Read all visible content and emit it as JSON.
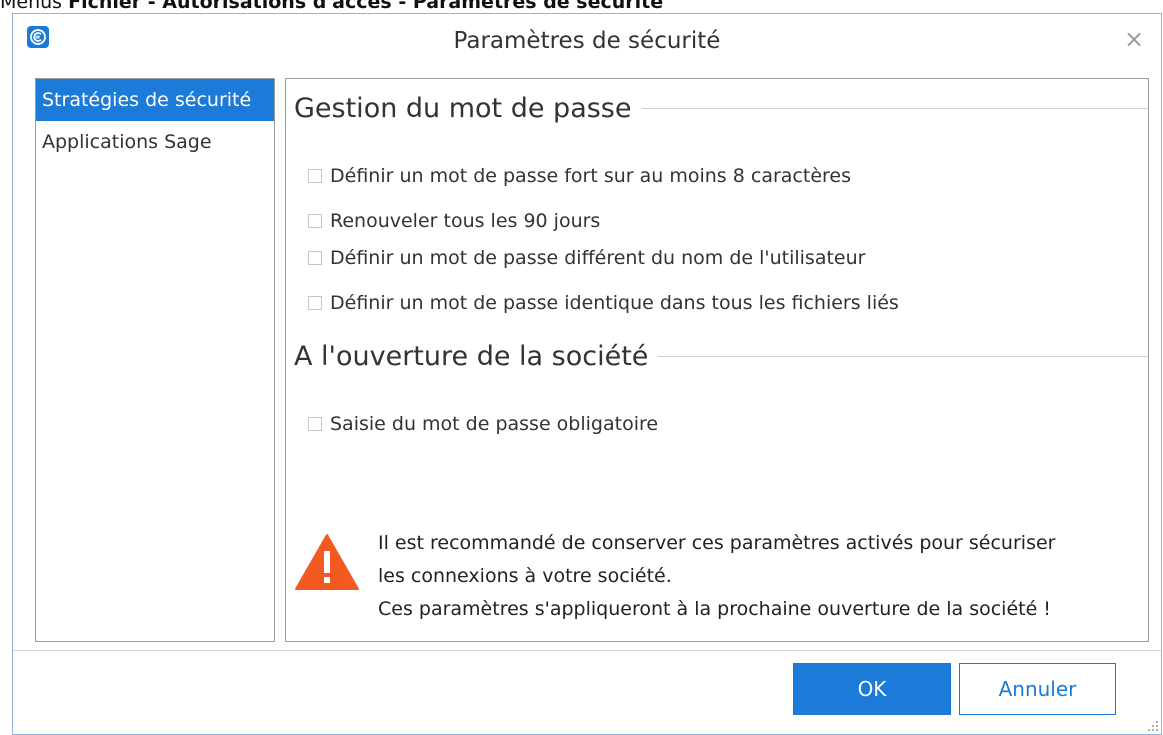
{
  "caption": {
    "prefix": "Menus ",
    "path": "Fichier - Autorisations d'accès - Paramètres de sécurité"
  },
  "dialog": {
    "title": "Paramètres de sécurité",
    "close_glyph": "×"
  },
  "sidebar": {
    "items": [
      {
        "label": "Stratégies de sécurité",
        "active": true
      },
      {
        "label": "Applications Sage",
        "active": false
      }
    ]
  },
  "sections": {
    "password": {
      "title": "Gestion du mot de passe",
      "options": [
        {
          "label": "Définir un mot de passe fort sur au moins 8 caractères",
          "checked": false
        },
        {
          "label": "Renouveler tous les 90 jours",
          "checked": false
        },
        {
          "label": "Définir un mot de passe différent du nom de l'utilisateur",
          "checked": false
        },
        {
          "label": "Définir un mot de passe identique dans tous les fichiers liés",
          "checked": false
        }
      ]
    },
    "opening": {
      "title": "A l'ouverture de la société",
      "options": [
        {
          "label": "Saisie du mot de passe obligatoire",
          "checked": false
        }
      ]
    }
  },
  "warning": {
    "lines": [
      "Il est recommandé de conserver ces paramètres activés pour sécuriser",
      "les connexions à votre société.",
      "Ces paramètres s'appliqueront à la prochaine ouverture de la société !"
    ]
  },
  "buttons": {
    "ok": "OK",
    "cancel": "Annuler"
  },
  "colors": {
    "accent": "#1c7ad9",
    "warning": "#f25a22"
  }
}
